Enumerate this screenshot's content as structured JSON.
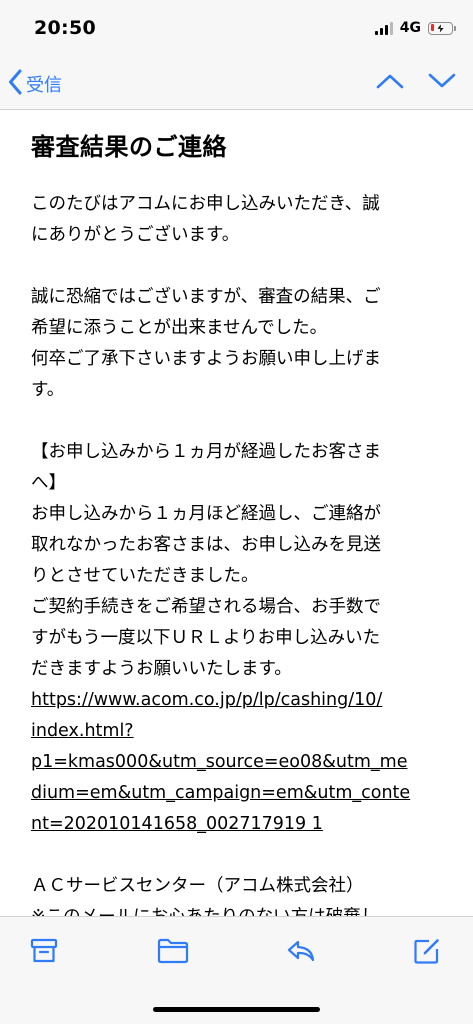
{
  "status_bar": {
    "time": "20:50",
    "network": "4G",
    "signal_bars_active": 3,
    "battery_level": 0.2,
    "battery_color": "#e5302b",
    "icons": [
      "signal-icon",
      "battery-charging-icon"
    ]
  },
  "nav": {
    "back_label": "受信",
    "accent_color": "#2f7cf6",
    "icons": [
      "chevron-left-icon",
      "chevron-up-icon",
      "chevron-down-icon"
    ]
  },
  "email": {
    "subject": "審査結果のご連絡",
    "lines": [
      "このたびはアコムにお申し込みいただき、誠",
      "にありがとうございます。",
      "誠に恐縮ではございますが、審査の結果、ご",
      "希望に添うことが出来ませんでした。",
      "何卒ご了承下さいますようお願い申し上げま",
      "す。",
      "【お申し込みから１ヵ月が経過したお客さま",
      "へ】",
      "お申し込みから１ヵ月ほど経過し、ご連絡が",
      "取れなかったお客さまは、お申し込みを見送",
      "りとさせていただきました。",
      "ご契約手続きをご希望される場合、お手数で",
      "すがもう一度以下ＵＲＬよりお申し込みいた",
      "だきますようお願いいたします。",
      "ＡＣサービスセンター（アコム株式会社）",
      "※このメールにお心あたりのない方は破棄し"
    ],
    "link_lines": [
      "https://www.acom.co.jp/p/lp/cashing/10/",
      "index.html?",
      "p1=kmas000&utm_source=eo08&utm_me",
      "dium=em&utm_campaign=em&utm_conte",
      "nt=202010141658_002717919 1"
    ]
  },
  "toolbar": {
    "icons": [
      "archive-icon",
      "folder-icon",
      "reply-icon",
      "compose-icon"
    ]
  }
}
